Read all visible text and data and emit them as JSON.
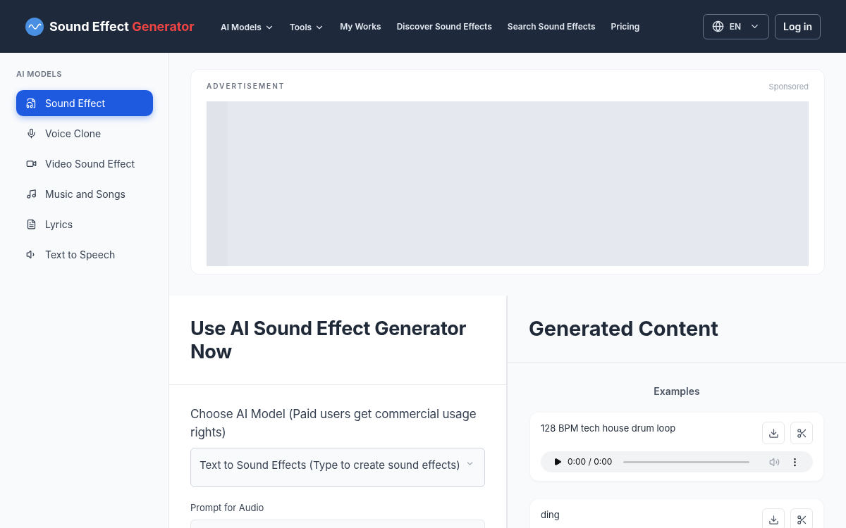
{
  "header": {
    "brand": {
      "first": "Sound Effect",
      "second": "Generator"
    },
    "nav": [
      {
        "label": "AI Models",
        "kind": "dropdown"
      },
      {
        "label": "Tools",
        "kind": "dropdown"
      },
      {
        "label": "My Works",
        "kind": "link"
      },
      {
        "label": "Discover Sound Effects",
        "kind": "link"
      },
      {
        "label": "Search Sound Effects",
        "kind": "link"
      },
      {
        "label": "Pricing",
        "kind": "link"
      }
    ],
    "language": "EN",
    "login": "Log in"
  },
  "sidebar": {
    "heading": "AI MODELS",
    "items": [
      {
        "label": "Sound Effect",
        "selected": true
      },
      {
        "label": "Voice Clone",
        "selected": false
      },
      {
        "label": "Video Sound Effect",
        "selected": false
      },
      {
        "label": "Music and Songs",
        "selected": false
      },
      {
        "label": "Lyrics",
        "selected": false
      },
      {
        "label": "Text to Speech",
        "selected": false
      }
    ]
  },
  "ad": {
    "label": "ADVERTISEMENT",
    "sponsored": "Sponsored"
  },
  "generator": {
    "title": "Use AI Sound Effect Generator Now",
    "model_label": "Choose AI Model (Paid users get commercial usage rights)",
    "model_value": "Text to Sound Effects (Type to create sound effects)",
    "prompt_label": "Prompt for Audio"
  },
  "generated": {
    "title": "Generated Content",
    "examples_heading": "Examples",
    "examples": [
      {
        "title": "128 BPM tech house drum loop",
        "time": "0:00 / 0:00"
      },
      {
        "title": "ding"
      }
    ]
  }
}
